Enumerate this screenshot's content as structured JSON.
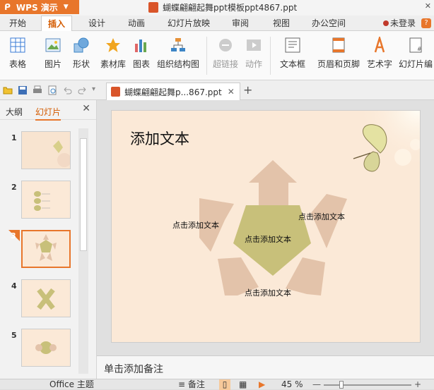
{
  "app": {
    "name": "WPS 演示",
    "doc_title": "蝴蝶翩翩起舞ppt模板ppt4867.ppt",
    "login": "未登录"
  },
  "ribbon_tabs": [
    "开始",
    "插入",
    "设计",
    "动画",
    "幻灯片放映",
    "审阅",
    "视图",
    "办公空间"
  ],
  "active_tab": "插入",
  "ribbon": {
    "table": "表格",
    "picture": "图片",
    "shape": "形状",
    "material": "素材库",
    "chart": "图表",
    "orgchart": "组织结构图",
    "hyperlink": "超链接",
    "action": "动作",
    "textbox": "文本框",
    "headerfooter": "页眉和页脚",
    "wordart": "艺术字",
    "slidenum": "幻灯片编"
  },
  "doc_tab": {
    "name": "蝴蝶翩翩起舞p...867.ppt"
  },
  "left_panel": {
    "tabs": [
      "大纲",
      "幻灯片"
    ],
    "active": "幻灯片",
    "thumb_numbers": [
      "1",
      "2",
      "3",
      "4",
      "5"
    ],
    "selected": "3"
  },
  "slide": {
    "title": "添加文本",
    "center_label": "点击添加文本",
    "left_label": "点击添加文本",
    "right_label": "点击添加文本",
    "bottom_label": "点击添加文本"
  },
  "notes": {
    "placeholder": "单击添加备注"
  },
  "status": {
    "theme": "Office 主题",
    "notes": "备注",
    "zoom": "45 %"
  },
  "colors": {
    "accent": "#e8762b",
    "arrow": "#e3c3aa",
    "pentagon": "#c8c07a",
    "slide_bg": "#fbe9d7"
  }
}
